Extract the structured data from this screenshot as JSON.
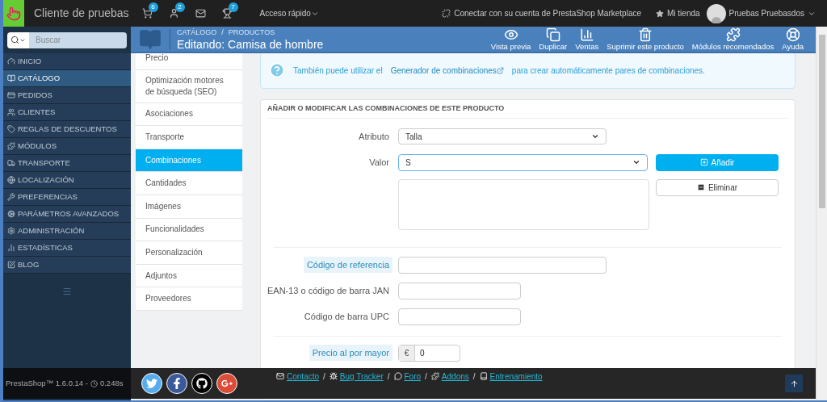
{
  "topbar": {
    "shop_name": "Cliente de pruebas",
    "notifications": [
      {
        "kind": "orders",
        "count": "6"
      },
      {
        "kind": "customers",
        "count": "2"
      },
      {
        "kind": "messages"
      },
      {
        "kind": "trophy",
        "count": "7"
      }
    ],
    "quick_access": "Acceso rápido",
    "marketplace_link": "Conectar con su cuenta de PrestaShop Marketplace",
    "shop_link": "Mi tienda",
    "user": "Pruebas Pruebasdos"
  },
  "sidebar": {
    "search": {
      "placeholder": "Buscar"
    },
    "items": [
      {
        "kind": "dashboard",
        "label": "INICIO",
        "selected": false
      },
      {
        "kind": "catalog",
        "label": "CATÁLOGO",
        "selected": true
      },
      {
        "kind": "orders",
        "label": "PEDIDOS",
        "selected": false
      },
      {
        "kind": "customers",
        "label": "CLIENTES",
        "selected": false
      },
      {
        "kind": "discounts",
        "label": "REGLAS DE DESCUENTOS",
        "selected": false
      },
      {
        "kind": "modules",
        "label": "MÓDULOS",
        "selected": false
      },
      {
        "kind": "shipping",
        "label": "TRANSPORTE",
        "selected": false
      },
      {
        "kind": "localization",
        "label": "LOCALIZACIÓN",
        "selected": false
      },
      {
        "kind": "preferences",
        "label": "PREFERENCIAS",
        "selected": false
      },
      {
        "kind": "advanced",
        "label": "PARÁMETROS AVANZADOS",
        "selected": false
      },
      {
        "kind": "admin",
        "label": "ADMINISTRACIÓN",
        "selected": false
      },
      {
        "kind": "stats",
        "label": "ESTADÍSTICAS",
        "selected": false
      },
      {
        "kind": "blog",
        "label": "BLOG",
        "selected": false
      }
    ]
  },
  "header": {
    "breadcrumb": [
      "CATÁLOGO",
      "PRODUCTOS"
    ],
    "separator": "/",
    "title": "Editando: Camisa de hombre",
    "toolbar": [
      {
        "kind": "preview",
        "label": "Vista previa"
      },
      {
        "kind": "duplicate",
        "label": "Duplicar"
      },
      {
        "kind": "sales",
        "label": "Ventas"
      },
      {
        "kind": "delete",
        "label": "Suprimir este producto"
      },
      {
        "kind": "modules",
        "label": "Módulos recomendados"
      },
      {
        "kind": "help",
        "label": "Ayuda"
      }
    ]
  },
  "tabs": [
    {
      "label": "Precio",
      "selected": false
    },
    {
      "label": "Optimización motores de búsqueda (SEO)",
      "selected": false
    },
    {
      "label": "Asociaciones",
      "selected": false
    },
    {
      "label": "Transporte",
      "selected": false
    },
    {
      "label": "Combinaciones",
      "selected": true
    },
    {
      "label": "Cantidades",
      "selected": false
    },
    {
      "label": "Imágenes",
      "selected": false
    },
    {
      "label": "Funcionalidades",
      "selected": false
    },
    {
      "label": "Personalización",
      "selected": false
    },
    {
      "label": "Adjuntos",
      "selected": false
    },
    {
      "label": "Proveedores",
      "selected": false
    }
  ],
  "info": {
    "text_before": "También puede utilizar el",
    "link": "Generador de combinaciones",
    "text_after": "para crear automáticamente pares de combinaciones."
  },
  "panel": {
    "heading": "AÑADIR O MODIFICAR LAS COMBINACIONES DE ESTE PRODUCTO",
    "attribute": {
      "label": "Atributo",
      "value": "Talla"
    },
    "value": {
      "label": "Valor",
      "value": "S"
    },
    "add_button": "Añadir",
    "remove_button": "Eliminar",
    "fields": [
      {
        "label": "Código de referencia",
        "highlighted": true
      },
      {
        "label": "EAN-13 o código de barra JAN",
        "highlighted": false
      },
      {
        "label": "Código de barra UPC",
        "highlighted": false
      }
    ],
    "wholesale": {
      "label": "Precio al por mayor",
      "highlighted": true,
      "currency": "€",
      "value": "0"
    }
  },
  "footer": {
    "separator": "/",
    "version": "PrestaShop™ 1.6.0.14 -",
    "time": "0.248s",
    "social": [
      {
        "kind": "twitter"
      },
      {
        "kind": "facebook"
      },
      {
        "kind": "github"
      },
      {
        "kind": "googleplus"
      }
    ],
    "links": [
      {
        "kind": "contact",
        "label": "Contacto"
      },
      {
        "kind": "bug",
        "label": "Bug Tracker"
      },
      {
        "kind": "forum",
        "label": "Foro"
      },
      {
        "kind": "addons",
        "label": "Addons"
      },
      {
        "kind": "training",
        "label": "Entrenamiento"
      }
    ]
  }
}
